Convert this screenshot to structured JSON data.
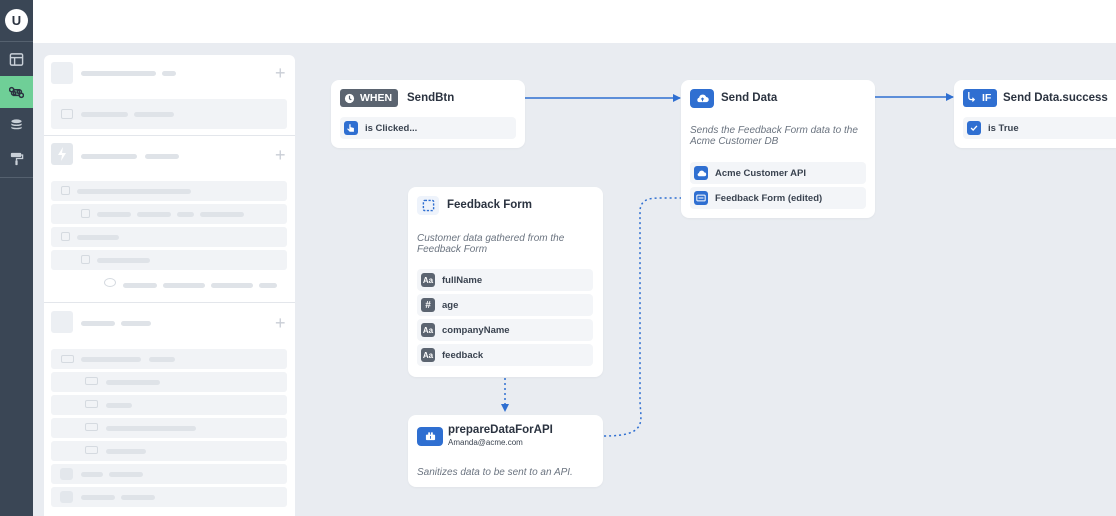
{
  "rail": {
    "logo": "U",
    "items": [
      {
        "name": "layout-icon"
      },
      {
        "name": "command-icon",
        "active": true
      },
      {
        "name": "database-icon"
      },
      {
        "name": "paint-roller-icon"
      }
    ]
  },
  "canvas": {
    "when_card": {
      "badge": "WHEN",
      "title": "SendBtn",
      "row": "is Clicked..."
    },
    "send_card": {
      "title": "Send Data",
      "description": "Sends the Feedback Form data to the Acme Customer DB",
      "rows": [
        "Acme Customer API",
        "Feedback Form (edited)"
      ]
    },
    "if_card": {
      "badge": "IF",
      "title": "Send Data.success",
      "row": "is True"
    },
    "form_card": {
      "title": "Feedback Form",
      "description": "Customer data gathered from the Feedback Form",
      "fields": [
        {
          "label": "fullName",
          "icon": "Aa"
        },
        {
          "label": "age",
          "icon": "#"
        },
        {
          "label": "companyName",
          "icon": "Aa"
        },
        {
          "label": "feedback",
          "icon": "Aa"
        }
      ]
    },
    "prep_card": {
      "title": "prepareDataForAPI",
      "subtitle": "Amanda@acme.com",
      "description": "Sanitizes data to be sent to an API."
    }
  },
  "colors": {
    "accent": "#2f6fd1",
    "rail": "#3a4655",
    "active": "#6fcf97",
    "badge_dark": "#5b6470"
  }
}
